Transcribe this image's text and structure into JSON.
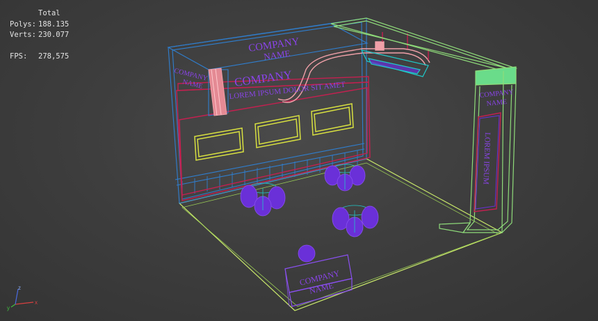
{
  "stats": {
    "header": "Total",
    "polys_label": "Polys:",
    "polys_value": "188.135",
    "verts_label": "Verts:",
    "verts_value": "230.077",
    "fps_label": "FPS:",
    "fps_value": "278,575"
  },
  "scene": {
    "wall_title": "COMPANY NAME",
    "wall_title_line1": "COMPANY",
    "wall_title_line2": "NAME",
    "banner_title": "COMPANY",
    "banner_subtitle": "LOREM IPSUM DOLOR SIT AMET",
    "left_panel_line1": "COMPANY",
    "left_panel_line2": "NAME",
    "right_panel_line1": "COMPANY",
    "right_panel_line2": "NAME",
    "vertical_sign": "LOREM IPSUM",
    "counter_line1": "COMPANY",
    "counter_line2": "NAME"
  },
  "axis": {
    "x_label": "x",
    "y_label": "y",
    "z_label": "z"
  },
  "colors": {
    "background": "#3a3a3a",
    "wireframe_blue": "#2f7fd0",
    "wireframe_green": "#8fdc7a",
    "wireframe_red": "#c42050",
    "wireframe_yellow": "#d8e040",
    "furniture_purple": "#6a30d8",
    "pink_panel": "#f0a0a8",
    "cyan_accent": "#20c8c8"
  }
}
